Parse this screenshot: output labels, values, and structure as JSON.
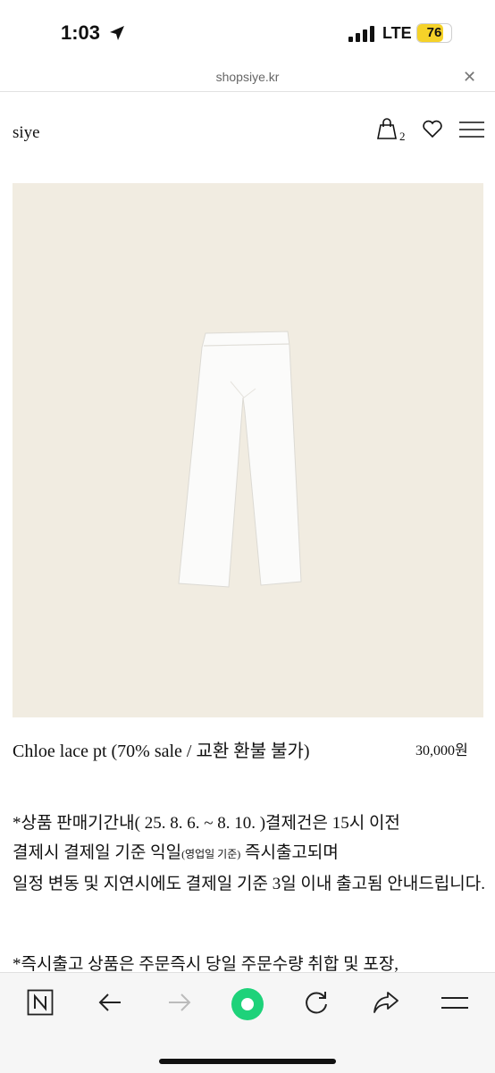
{
  "status_bar": {
    "time": "1:03",
    "network": "LTE",
    "battery": "76",
    "battery_level": 0.76,
    "icons": [
      "location-arrow-icon",
      "signal-icon",
      "battery-icon"
    ]
  },
  "browser": {
    "url": "shopsiye.kr",
    "close_icon": "close-icon"
  },
  "header": {
    "brand": "siye",
    "cart_count": "2",
    "icons": [
      "shopping-bag-icon",
      "heart-icon",
      "menu-icon"
    ]
  },
  "product": {
    "name": "Chloe lace pt (70% sale / 교환 환불 불가)",
    "price": "30,000원",
    "image_bg": "#f1ece1"
  },
  "description": {
    "line1": "*상품 판매기간내( 25. 8. 6. ~ 8. 10. )결제건은 15시 이전",
    "line2_a": "결제시 결제일 기준 익일",
    "line2_small": "(영업일 기준)",
    "line2_b": " 즉시출고되며",
    "line3": "일정 변동 및 지연시에도 결제일 기준 3일 이내 출고됨 안내드립니다.",
    "line4": "*즉시출고 상품은 주문즉시 당일 주문수량 취합 및 포장,"
  },
  "toolbar": {
    "icons": [
      "naver-home-icon",
      "back-arrow-icon",
      "forward-arrow-icon",
      "green-dot-icon",
      "refresh-icon",
      "share-icon",
      "menu-icon"
    ],
    "accent": "#1ed27a"
  }
}
